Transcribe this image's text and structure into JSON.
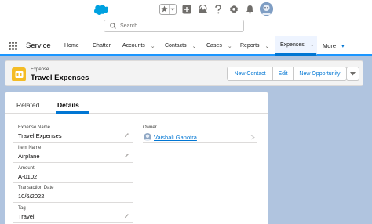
{
  "header": {
    "search_placeholder": "Search...",
    "icons": [
      "salesforce-cloud-logo",
      "star-icon",
      "chevron-down-icon",
      "add-icon",
      "trailhead-icon",
      "help-icon",
      "gear-icon",
      "bell-icon",
      "avatar"
    ]
  },
  "nav": {
    "app_name": "Service",
    "items": [
      {
        "label": "Home"
      },
      {
        "label": "Chatter"
      },
      {
        "label": "Accounts"
      },
      {
        "label": "Contacts"
      },
      {
        "label": "Cases"
      },
      {
        "label": "Reports"
      },
      {
        "label": "Expenses"
      },
      {
        "label": "More"
      }
    ],
    "active": "Expenses"
  },
  "record": {
    "object_type": "Expense",
    "title": "Travel Expenses",
    "buttons": {
      "new_contact": "New Contact",
      "edit": "Edit",
      "new_opportunity": "New Opportunity"
    }
  },
  "tabs": {
    "related": "Related",
    "details": "Details",
    "active": "Details"
  },
  "fields": [
    {
      "label": "Expense Name",
      "value": "Travel Expenses"
    },
    {
      "label": "Item Name",
      "value": "Airplane"
    },
    {
      "label": "Amount",
      "value": "A-0102"
    },
    {
      "label": "Transaction Date",
      "value": "10/6/2022"
    },
    {
      "label": "Tag",
      "value": "Travel"
    }
  ],
  "owner": {
    "label": "Owner",
    "name": "Vaishali Ganotra"
  },
  "colors": {
    "brand_blue": "#0176d3",
    "nav_active_bg": "#eef4ff",
    "page_background": "#b0c4df",
    "object_icon": "#f4bc25"
  }
}
